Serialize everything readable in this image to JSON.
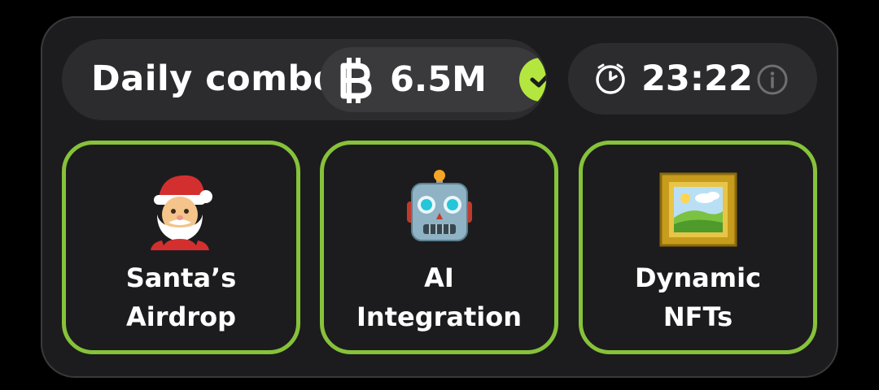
{
  "combo": {
    "title": "Daily combo",
    "reward": "6.5M",
    "coin_icon": "coin-icon",
    "check_icon": "check-icon",
    "accent": "#b3e73f"
  },
  "timer": {
    "value": "23:22",
    "clock_icon": "clock-icon",
    "info_icon": "info-icon"
  },
  "cards": [
    {
      "line1": "Santa’s",
      "line2": "Airdrop",
      "icon": "santa-emoji-icon"
    },
    {
      "line1": "AI",
      "line2": "Integration",
      "icon": "robot-emoji-icon"
    },
    {
      "line1": "Dynamic",
      "line2": "NFTs",
      "icon": "framed-picture-emoji-icon"
    }
  ],
  "colors": {
    "card_border": "#86c23a",
    "background": "#1c1c1e",
    "pill": "#2c2c2e"
  }
}
